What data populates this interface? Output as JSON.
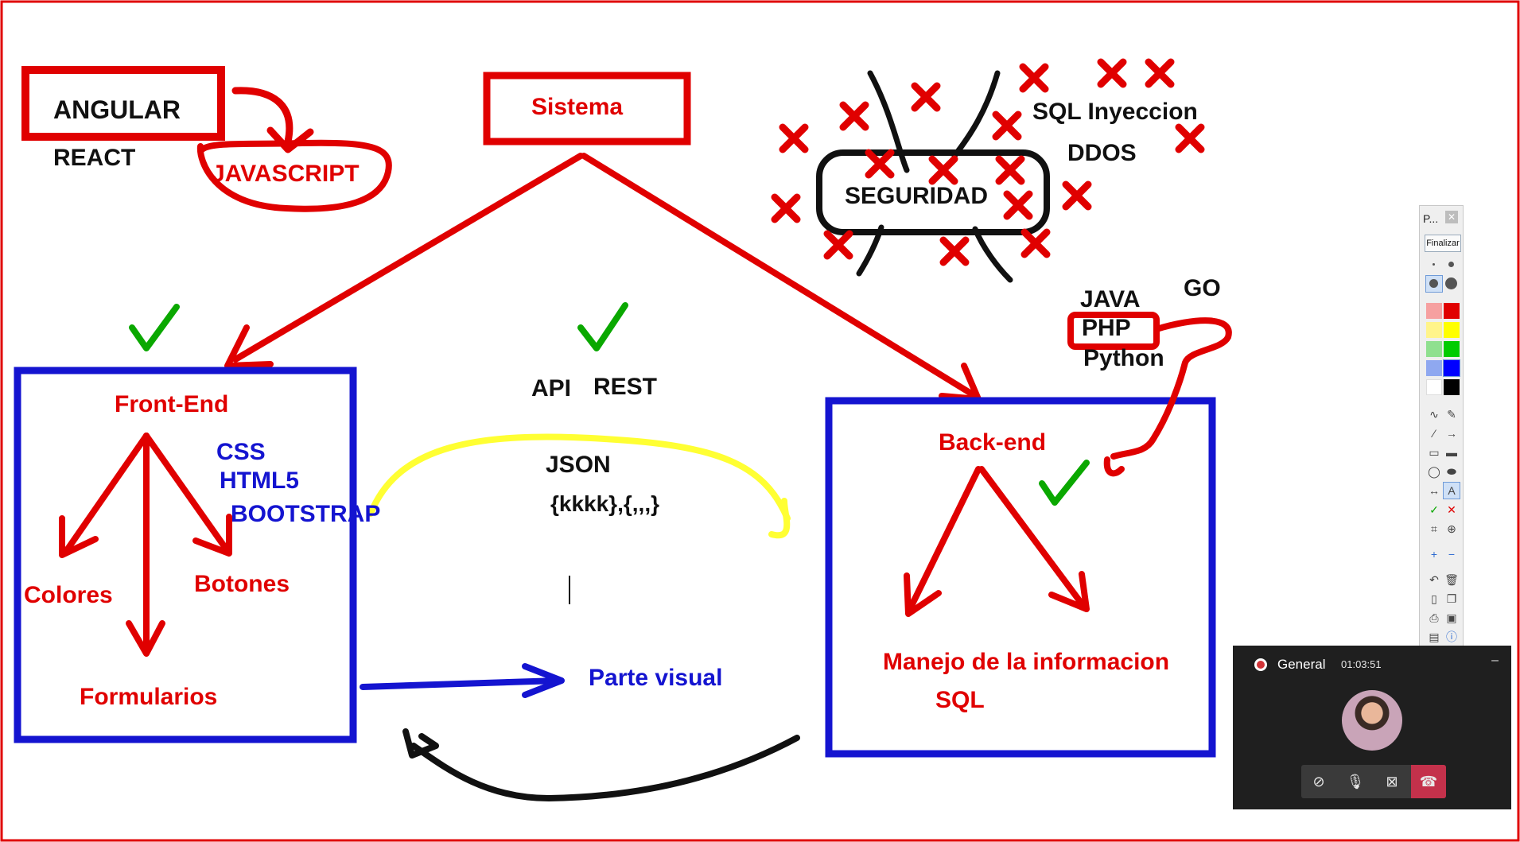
{
  "whiteboard": {
    "texts": {
      "angular": "ANGULAR",
      "react": "REACT",
      "javascript": "JAVASCRIPT",
      "sistema": "Sistema",
      "seguridad": "SEGURIDAD",
      "sql_inyeccion": "SQL Inyeccion",
      "ddos": "DDOS",
      "java": "JAVA",
      "go": "GO",
      "php": "PHP",
      "python": "Python",
      "front_end": "Front-End",
      "css": "CSS",
      "html5": "HTML5",
      "bootstrap": "BOOTSTRAP",
      "colores": "Colores",
      "botones": "Botones",
      "formularios": "Formularios",
      "api": "API",
      "rest": "REST",
      "json": "JSON",
      "json_example": "{kkkk},{,,,}",
      "parte_visual": "Parte visual",
      "back_end": "Back-end",
      "manejo": "Manejo de la informacion",
      "sql": "SQL"
    },
    "colors": {
      "red": "#e00000",
      "blue": "#1414d0",
      "black": "#111111",
      "green": "#0aa800",
      "yellow": "#ffff33"
    }
  },
  "pen_toolbar": {
    "title": "P...",
    "close_icon": "close-icon",
    "finish_label": "Finalizar",
    "swatches": [
      "#f6a0a0",
      "#e00000",
      "#fff48a",
      "#ffff00",
      "#8fe08f",
      "#00cc00",
      "#8fa8f0",
      "#0000ff",
      "#ffffff",
      "#000000"
    ]
  },
  "call": {
    "name": "General",
    "timer": "01:03:51",
    "minimize_label": "–"
  }
}
